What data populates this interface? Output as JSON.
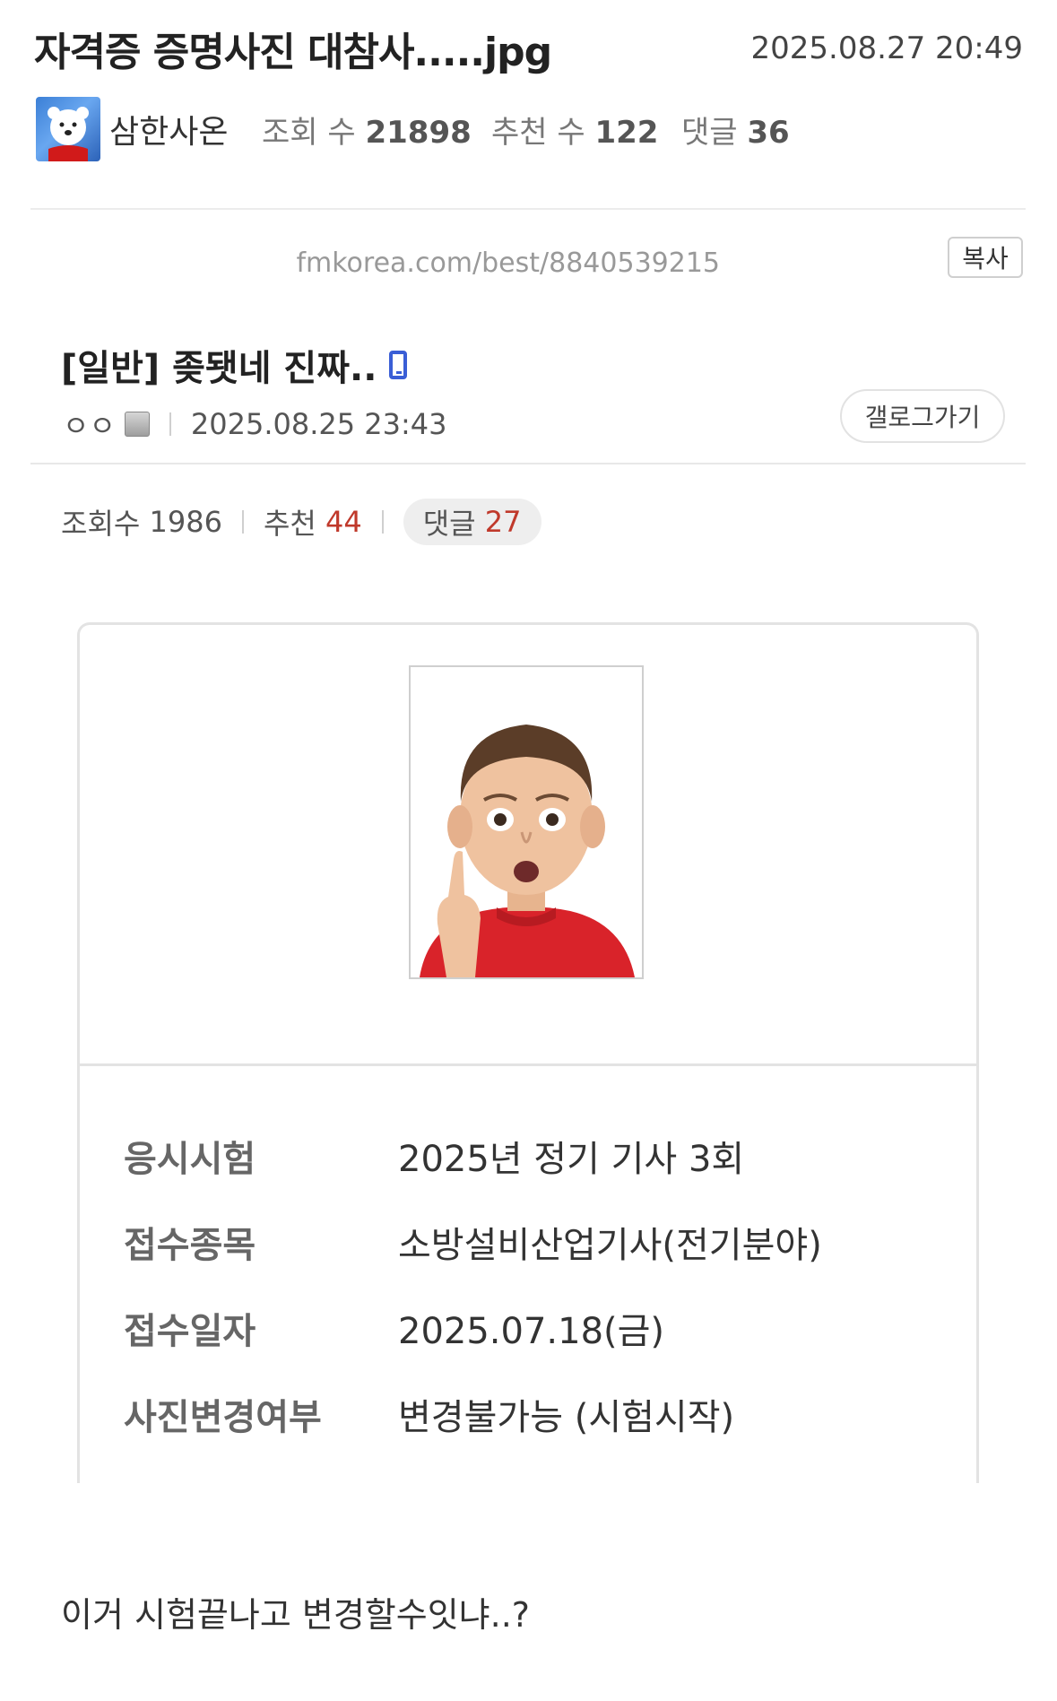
{
  "header": {
    "title": "자격증 증명사진 대참사.....jpg",
    "datetime": "2025.08.27 20:49",
    "author": "삼한사온",
    "views_label": "조회 수",
    "views": "21898",
    "recommend_label": "추천 수",
    "recommend": "122",
    "comments_label": "댓글",
    "comments": "36"
  },
  "share": {
    "url": "fmkorea.com/best/8840539215",
    "copy_label": "복사"
  },
  "original_post": {
    "title": "[일반] 좆됏네 진짜..",
    "nickname": "ㅇㅇ",
    "datetime": "2025.08.25 23:43",
    "gallery_button": "갤로그가기",
    "views_label": "조회수",
    "views": "1986",
    "recommend_label": "추천",
    "recommend": "44",
    "comments_label": "댓글",
    "comments": "27"
  },
  "card": {
    "rows": [
      {
        "label": "응시시험",
        "value": "2025년 정기 기사 3회"
      },
      {
        "label": "접수종목",
        "value": "소방설비산업기사(전기분야)"
      },
      {
        "label": "접수일자",
        "value": "2025.07.18(금)"
      },
      {
        "label": "사진변경여부",
        "value": "변경불가능 (시험시작)"
      }
    ]
  },
  "body": {
    "text": "이거 시험끝나고 변경할수잇냐..?"
  },
  "colors": {
    "accent_red": "#c0392b",
    "phone_icon_blue": "#3a5ed6"
  }
}
